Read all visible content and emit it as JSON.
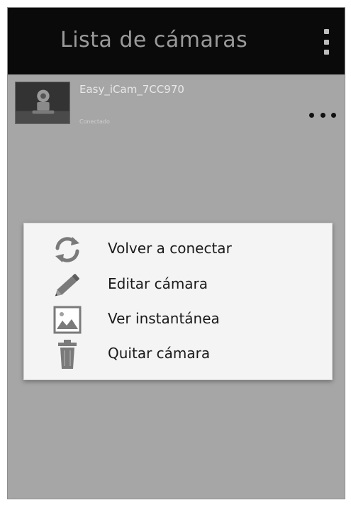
{
  "header": {
    "title": "Lista de cámaras",
    "overflow_icon": "vertical-dots-icon"
  },
  "camera_list": [
    {
      "name": "Easy_iCam_7CC970",
      "status": "Conectado",
      "thumbnail_icon": "camera-thumbnail",
      "more_icon": "horizontal-dots-icon"
    }
  ],
  "context_menu": {
    "items": [
      {
        "label": "Volver a conectar",
        "icon": "refresh-icon"
      },
      {
        "label": "Editar cámara",
        "icon": "pencil-icon"
      },
      {
        "label": "Ver instantánea",
        "icon": "image-icon"
      },
      {
        "label": "Quitar cámara",
        "icon": "trash-icon"
      }
    ]
  },
  "colors": {
    "background": "#a6a6a6",
    "titlebar": "#0a0a0a",
    "dialog": "#f4f4f4",
    "icon": "#7a7a7a"
  }
}
